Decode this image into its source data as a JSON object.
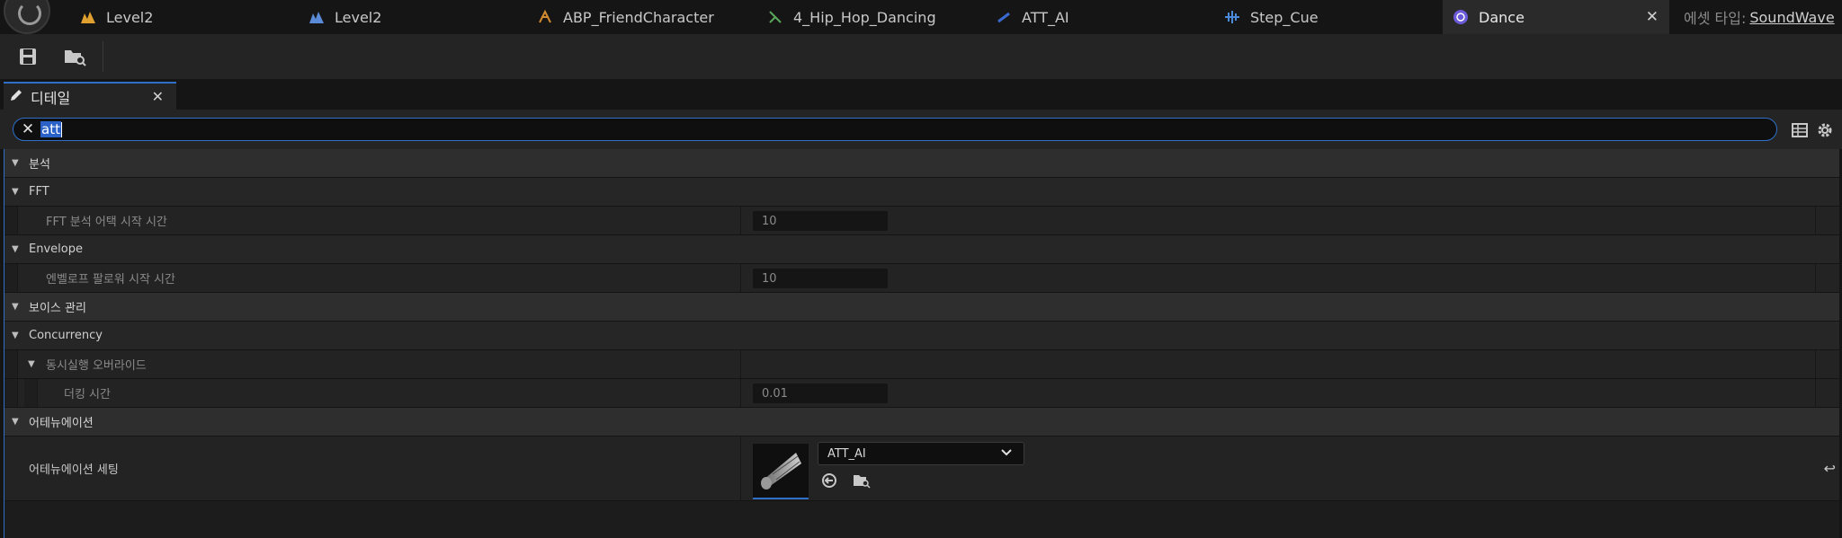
{
  "tabs": [
    {
      "label": "Level2",
      "icon": "level-icon",
      "color": "#e0a030"
    },
    {
      "label": "Level2",
      "icon": "level-icon",
      "color": "#5a8ad8"
    },
    {
      "label": "ABP_FriendCharacter",
      "icon": "anim-blueprint-icon",
      "color": "#d08a30"
    },
    {
      "label": "4_Hip_Hop_Dancing",
      "icon": "anim-sequence-icon",
      "color": "#5aa85a"
    },
    {
      "label": "ATT_AI",
      "icon": "attenuation-icon",
      "color": "#3a6ad0"
    },
    {
      "label": "Step_Cue",
      "icon": "sound-cue-icon",
      "color": "#4a8ad8"
    },
    {
      "label": "Dance",
      "icon": "sound-wave-icon",
      "color": "#6a5ad8",
      "active": true
    }
  ],
  "asset_type": {
    "label": "에셋 타입:",
    "value": "SoundWave"
  },
  "details_tab": {
    "label": "디테일"
  },
  "search": {
    "value": "att"
  },
  "rows": {
    "analysis": "분석",
    "fft": "FFT",
    "fft_attack": "FFT 분석 어택 시작 시간",
    "fft_attack_value": "10",
    "envelope": "Envelope",
    "envelope_attack": "엔벨로프 팔로워 시작 시간",
    "envelope_attack_value": "10",
    "voice_management": "보이스 관리",
    "concurrency": "Concurrency",
    "concurrency_override": "동시실행 오버라이드",
    "ducking_time": "더킹 시간",
    "ducking_time_value": "0.01",
    "attenuation": "어테뉴에이션",
    "attenuation_settings": "어테뉴에이션 세팅",
    "attenuation_asset": "ATT_AI"
  },
  "colors": {
    "accent": "#2f6fc8",
    "panel": "#242424",
    "background": "#151515"
  }
}
